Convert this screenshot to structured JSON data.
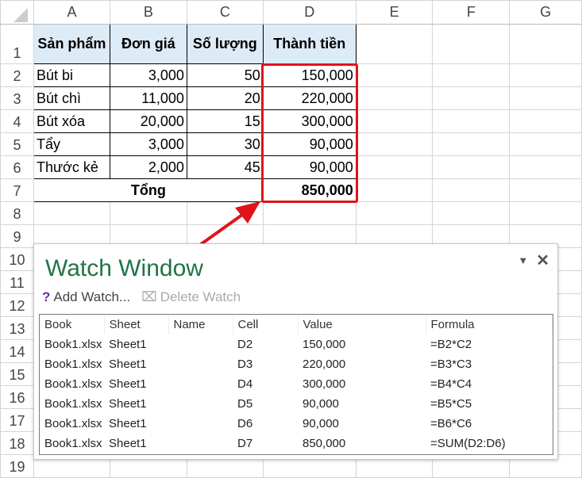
{
  "columns": [
    "A",
    "B",
    "C",
    "D",
    "E",
    "F",
    "G"
  ],
  "rows": [
    "1",
    "2",
    "3",
    "4",
    "5",
    "6",
    "7",
    "8",
    "9",
    "10",
    "11",
    "12",
    "13",
    "14",
    "15",
    "16",
    "17",
    "18",
    "19"
  ],
  "table": {
    "headers": [
      "Sản phẩm",
      "Đơn giá",
      "Số lượng",
      "Thành tiền"
    ],
    "items": [
      [
        "Bút bi",
        "3,000",
        "50",
        "150,000"
      ],
      [
        "Bút chì",
        "11,000",
        "20",
        "220,000"
      ],
      [
        "Bút xóa",
        "20,000",
        "15",
        "300,000"
      ],
      [
        "Tẩy",
        "3,000",
        "30",
        "90,000"
      ],
      [
        "Thước kẻ",
        "2,000",
        "45",
        "90,000"
      ]
    ],
    "total_label": "Tổng",
    "total_value": "850,000"
  },
  "highlight_color": "#e0131a",
  "watch": {
    "title": "Watch Window",
    "add_label": "Add Watch...",
    "delete_label": "Delete Watch",
    "headers": [
      "Book",
      "Sheet",
      "Name",
      "Cell",
      "Value",
      "Formula"
    ],
    "rows": [
      [
        "Book1.xlsx",
        "Sheet1",
        "",
        "D2",
        "150,000",
        "=B2*C2"
      ],
      [
        "Book1.xlsx",
        "Sheet1",
        "",
        "D3",
        "220,000",
        "=B3*C3"
      ],
      [
        "Book1.xlsx",
        "Sheet1",
        "",
        "D4",
        "300,000",
        "=B4*C4"
      ],
      [
        "Book1.xlsx",
        "Sheet1",
        "",
        "D5",
        "90,000",
        "=B5*C5"
      ],
      [
        "Book1.xlsx",
        "Sheet1",
        "",
        "D6",
        "90,000",
        "=B6*C6"
      ],
      [
        "Book1.xlsx",
        "Sheet1",
        "",
        "D7",
        "850,000",
        "=SUM(D2:D6)"
      ]
    ]
  }
}
